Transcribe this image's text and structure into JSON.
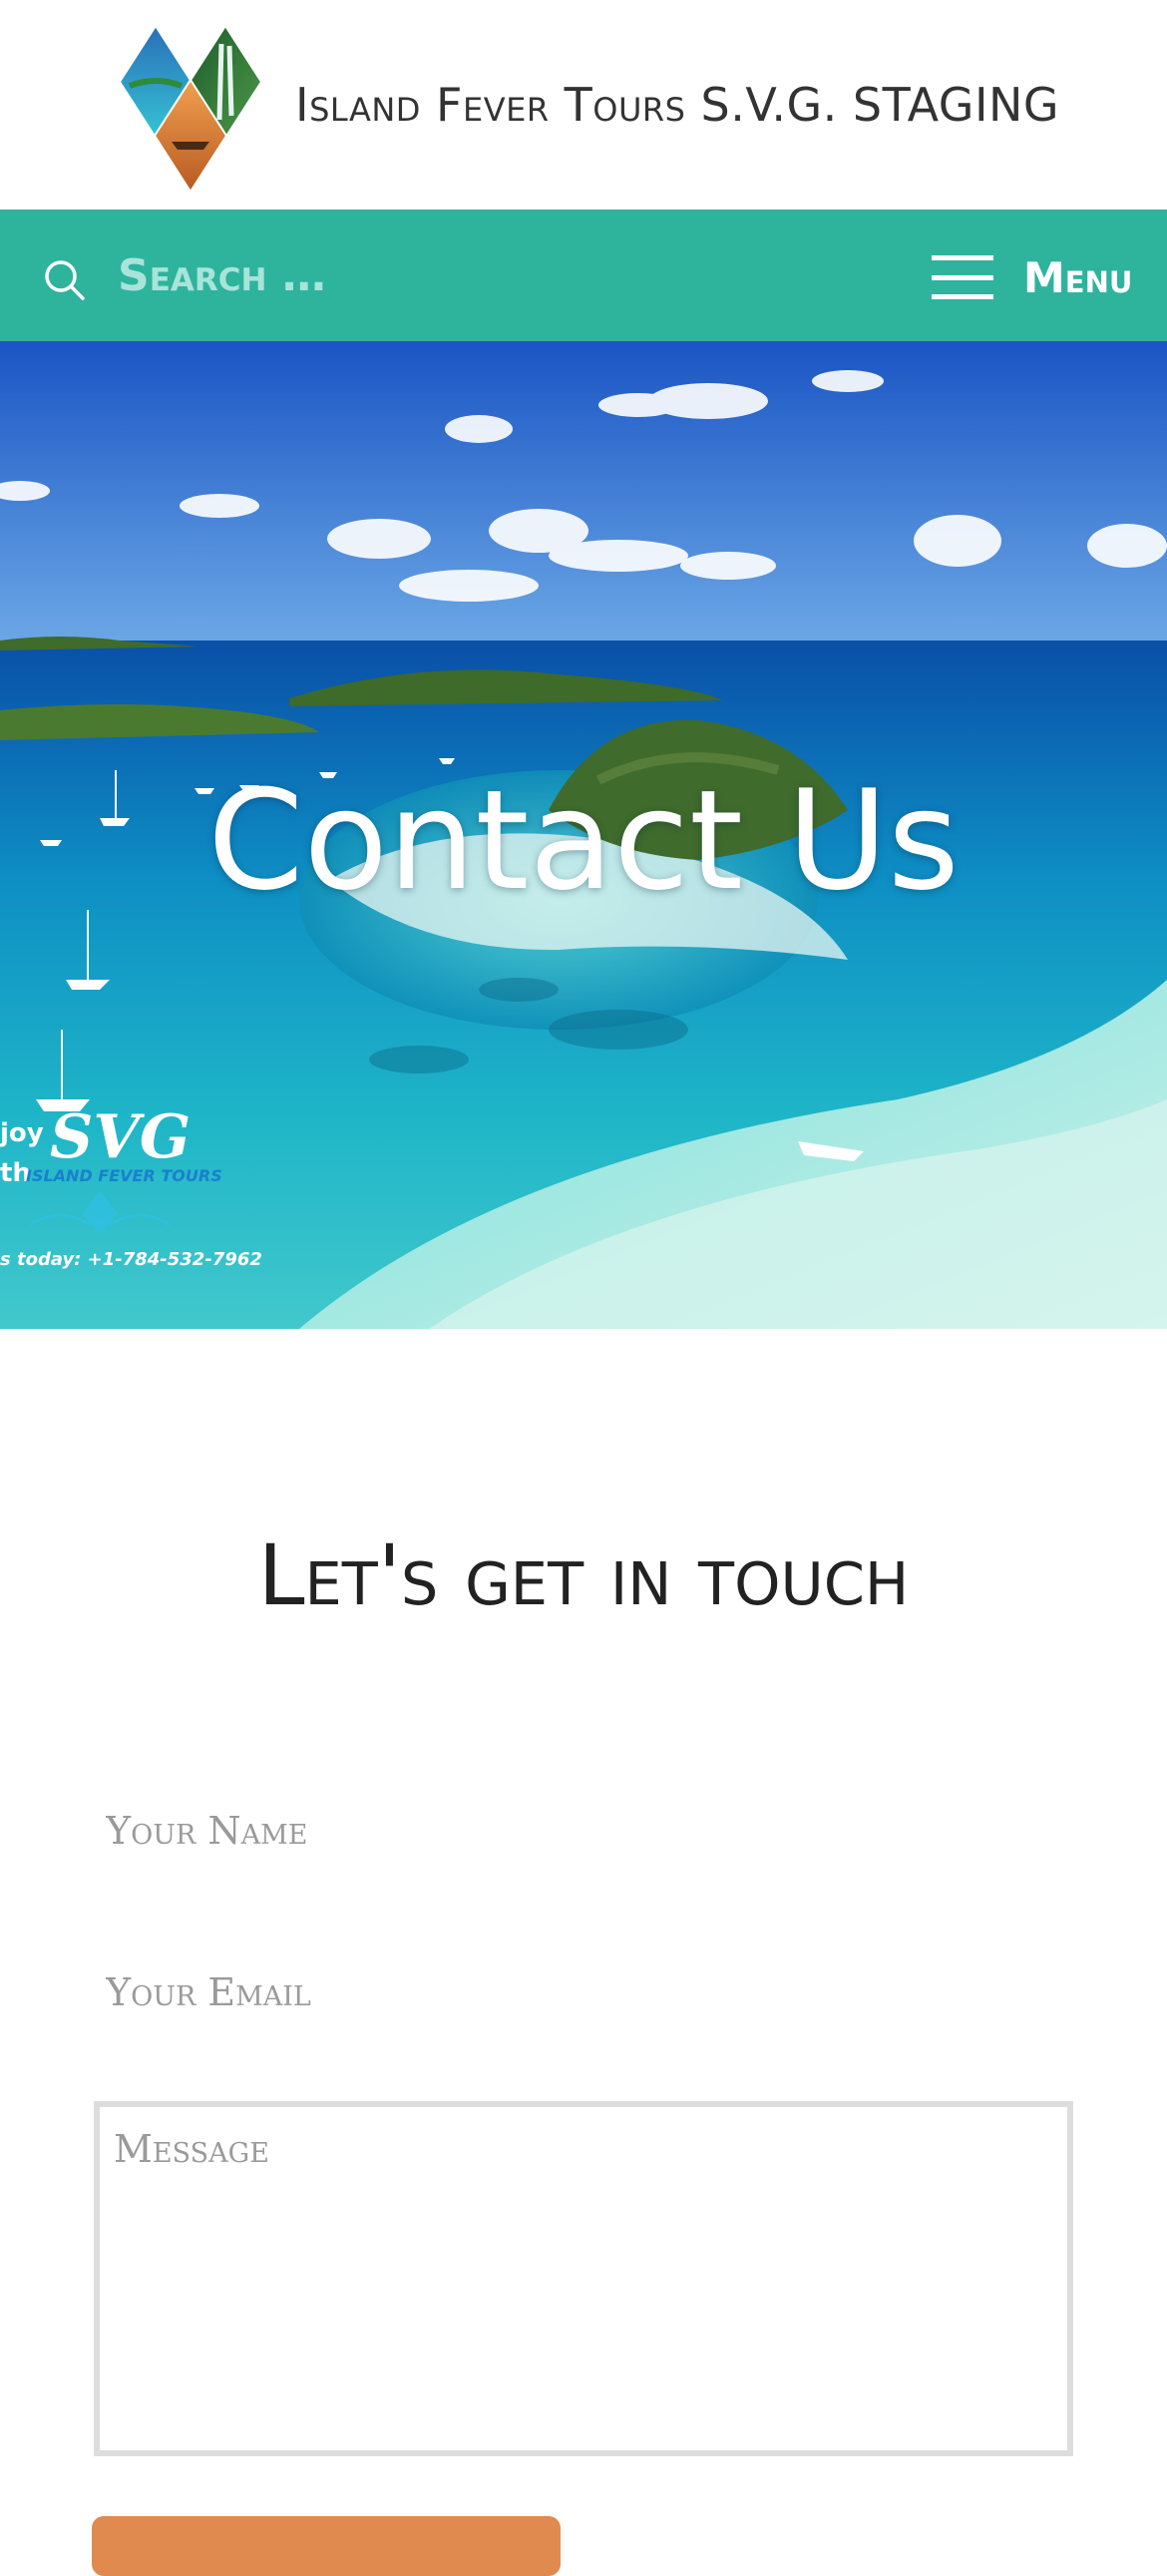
{
  "header": {
    "site_title": "Island Fever Tours S.V.G. STAGING",
    "logo_icon": "diamond-logo-icon"
  },
  "nav": {
    "search_placeholder": "Search …",
    "menu_label": "Menu",
    "accent_color": "#2eb39d"
  },
  "hero": {
    "title": "Contact Us",
    "badge_line_1": "joy",
    "badge_line_2": "th",
    "badge_brand": "SVG",
    "badge_sub": "ISLAND FEVER TOURS",
    "badge_phone": "s today: +1-784-532-7962"
  },
  "contact": {
    "heading": "Let's get in touch",
    "name_placeholder": "Your Name",
    "email_placeholder": "Your Email",
    "message_placeholder": "Message",
    "submit_color": "#e08a4f"
  }
}
